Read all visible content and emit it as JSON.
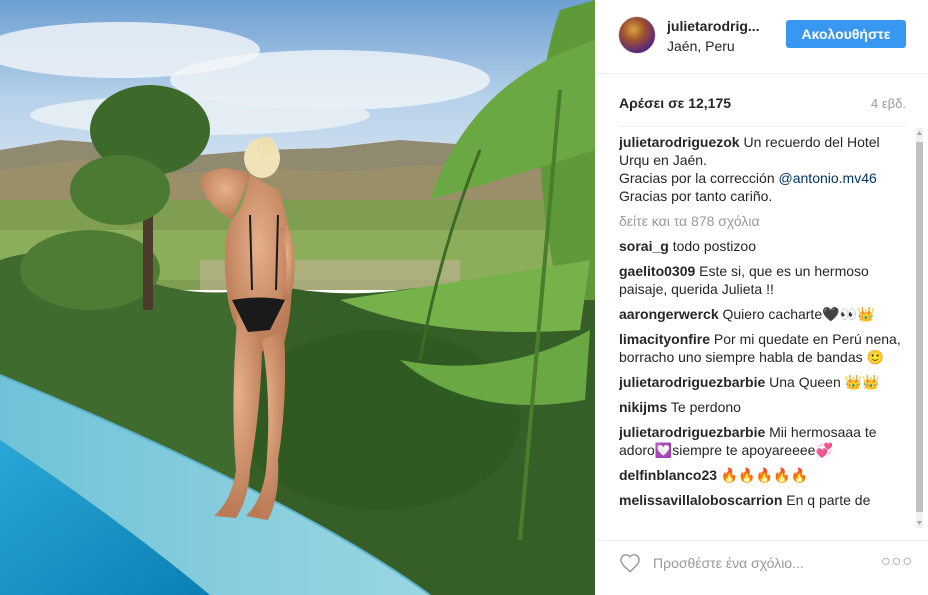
{
  "header": {
    "username": "julietarodrig...",
    "location": "Jaén, Peru",
    "follow_label": "Ακολουθήστε"
  },
  "stats": {
    "likes": "Αρέσει σε 12,175",
    "time_ago": "4 εβδ."
  },
  "caption": {
    "user": "julietarodriguezok",
    "text1": "Un recuerdo del Hotel Urqu en Jaén.",
    "text2": "Gracias por la corrección",
    "mention": "@antonio.mv46",
    "text3": "Gracias por tanto cariño."
  },
  "view_all": "δείτε και τα 878 σχόλια",
  "comments": [
    {
      "user": "sorai_g",
      "text": "todo postizoo"
    },
    {
      "user": "gaelito0309",
      "text": "Este si, que es un hermoso paisaje, querida Julieta !!"
    },
    {
      "user": "aarongerwerck",
      "text": "Quiero cacharte🖤👀👑"
    },
    {
      "user": "limacityonfire",
      "text": "Por mi quedate en Perú nena, borracho uno siempre habla de bandas 🙂"
    },
    {
      "user": "julietarodriguezbarbie",
      "text": "Una Queen 👑👑"
    },
    {
      "user": "nikijms",
      "text": "Te perdono"
    },
    {
      "user": "julietarodriguezbarbie",
      "text": "Mii hermosaaa te adoro💟siempre te apoyareeee💞"
    },
    {
      "user": "delfinblanco23",
      "text": "🔥🔥🔥🔥🔥"
    },
    {
      "user": "melissavillaloboscarrion",
      "text": "En q parte de"
    }
  ],
  "footer": {
    "comment_placeholder": "Προσθέστε ένα σχόλιο...",
    "more_label": "○○○",
    "heart_icon": "heart-outline-icon"
  },
  "colors": {
    "follow_blue": "#3897f0",
    "mention_blue": "#003569",
    "muted_gray": "#999999"
  }
}
